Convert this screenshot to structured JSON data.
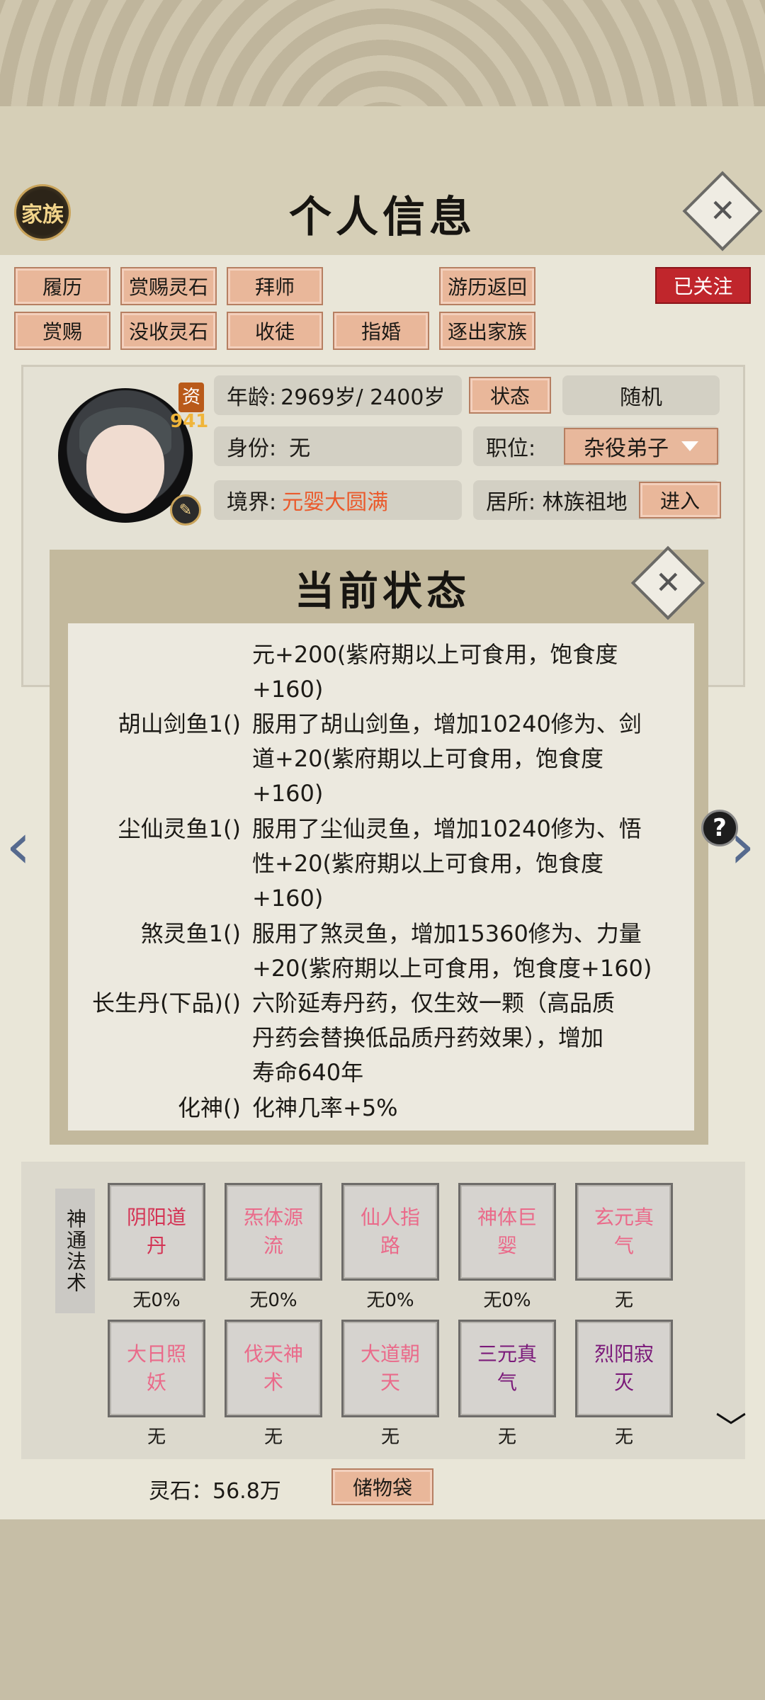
{
  "header": {
    "clan_label": "家族",
    "title": "个人信息"
  },
  "actions": {
    "row1": [
      "履历",
      "赏赐灵石",
      "拜师",
      "游历返回"
    ],
    "row2": [
      "赏赐",
      "没收灵石",
      "收徒",
      "指婚",
      "逐出家族"
    ],
    "follow": "已关注"
  },
  "profile": {
    "aptitude_label": "资",
    "aptitude_value": "941",
    "age_label": "年龄:",
    "age_value": "2969岁/ 2400岁",
    "status_btn": "状态",
    "random_btn": "随机",
    "identity_label": "身份:",
    "identity_value": "无",
    "position_label": "职位:",
    "position_value": "杂役弟子",
    "realm_label": "境界:",
    "realm_value": "元婴大圆满",
    "residence_label": "居所: 林族祖地",
    "enter_btn": "进入"
  },
  "modal": {
    "title": "当前状态",
    "rows": [
      {
        "name": "",
        "lines": [
          "元+200(紫府期以上可食用，饱食度",
          "+160)"
        ]
      },
      {
        "name": "胡山剑鱼1()",
        "lines": [
          "服用了胡山剑鱼，增加10240修为、剑",
          "道+20(紫府期以上可食用，饱食度",
          "+160)"
        ]
      },
      {
        "name": "尘仙灵鱼1()",
        "lines": [
          "服用了尘仙灵鱼，增加10240修为、悟",
          "性+20(紫府期以上可食用，饱食度",
          "+160)"
        ]
      },
      {
        "name": "煞灵鱼1()",
        "lines": [
          "服用了煞灵鱼，增加15360修为、力量",
          "+20(紫府期以上可食用，饱食度+160)"
        ]
      },
      {
        "name": "长生丹(下品)()",
        "lines": [
          "六阶延寿丹药，仅生效一颗（高品质",
          "丹药会替换低品质丹药效果），增加",
          "寿命640年"
        ]
      },
      {
        "name": "化神()",
        "lines": [
          "化神几率+5%"
        ]
      }
    ]
  },
  "skills": {
    "category": "神通法术",
    "items": [
      {
        "name": "阴阳道丹",
        "level": "无0%",
        "color": "#d43455"
      },
      {
        "name": "炁体源流",
        "level": "无0%",
        "color": "#ea6a8a"
      },
      {
        "name": "仙人指路",
        "level": "无0%",
        "color": "#ea6a8a"
      },
      {
        "name": "神体巨婴",
        "level": "无0%",
        "color": "#ea6a8a"
      },
      {
        "name": "玄元真气",
        "level": "无",
        "color": "#ea6a8a"
      },
      {
        "name": "大日照妖",
        "level": "无",
        "color": "#ea6a8a"
      },
      {
        "name": "伐天神术",
        "level": "无",
        "color": "#ea6a8a"
      },
      {
        "name": "大道朝天",
        "level": "无",
        "color": "#ea6a8a"
      },
      {
        "name": "三元真气",
        "level": "无",
        "color": "#7b1a7a"
      },
      {
        "name": "烈阳寂灭",
        "level": "无",
        "color": "#7b1a7a"
      }
    ]
  },
  "footer": {
    "spirit_stone": "灵石：56.8万",
    "bag_btn": "储物袋"
  },
  "icons": [
    "close-icon",
    "edit-icon",
    "help-icon",
    "arrow-left-icon",
    "arrow-right-icon",
    "chevron-down-icon"
  ]
}
